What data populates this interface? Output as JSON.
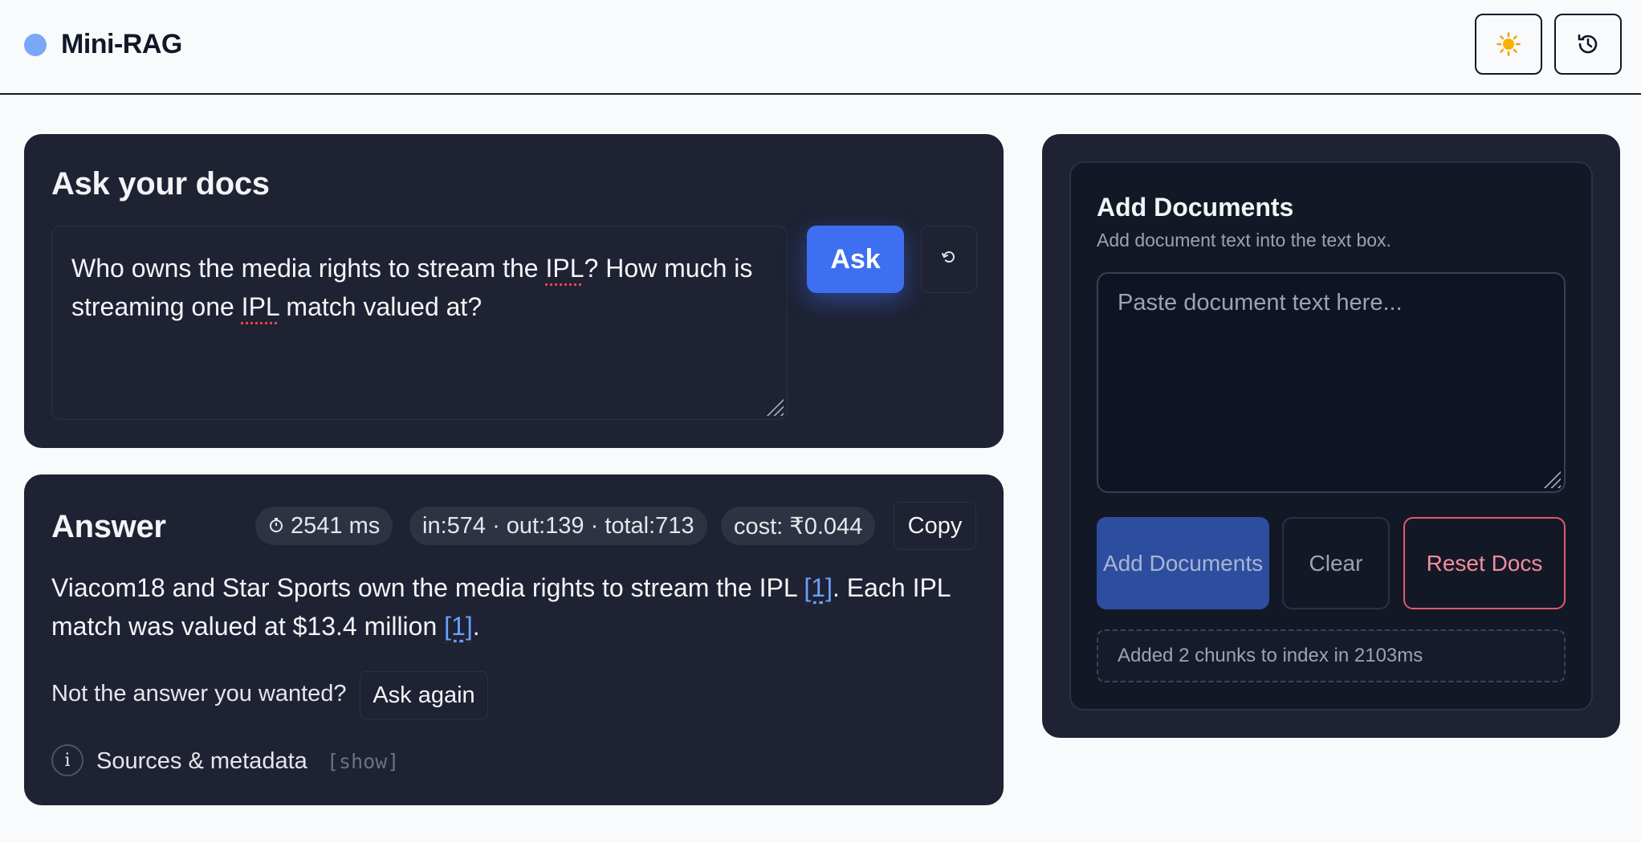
{
  "header": {
    "title": "Mini-RAG",
    "theme_icon": "sun-icon",
    "history_icon": "history-icon",
    "brand_color": "#7aa7f7"
  },
  "ask": {
    "title": "Ask your docs",
    "question_part1": "Who owns the media rights to stream the ",
    "question_ipl1": "IPL",
    "question_part2": "? How much is streaming one ",
    "question_ipl2": "IPL",
    "question_part3": " match valued at?",
    "ask_label": "Ask",
    "reset_icon": "reset-icon"
  },
  "answer": {
    "title": "Answer",
    "time": "2541 ms",
    "tokens": "in:574 · out:139 · total:713",
    "cost": "cost: ₹0.044",
    "copy_label": "Copy",
    "text_part1": "Viacom18 and Star Sports own the media rights to stream the IPL ",
    "cite1": "[1]",
    "text_part2": ". Each IPL match was valued at $13.4 million ",
    "cite2": "[1]",
    "text_part3": ".",
    "feedback_label": "Not the answer you wanted?",
    "ask_again_label": "Ask again",
    "sources_label": "Sources & metadata",
    "show_label": "[show]"
  },
  "docs": {
    "title": "Add Documents",
    "subtitle": "Add document text into the text box.",
    "placeholder": "Paste document text here...",
    "add_label": "Add Documents",
    "clear_label": "Clear",
    "reset_label": "Reset Docs",
    "status": "Added 2 chunks to index in 2103ms"
  },
  "colors": {
    "accent": "#3e6ff0",
    "card": "#1e2233",
    "danger": "#e05a6a"
  }
}
